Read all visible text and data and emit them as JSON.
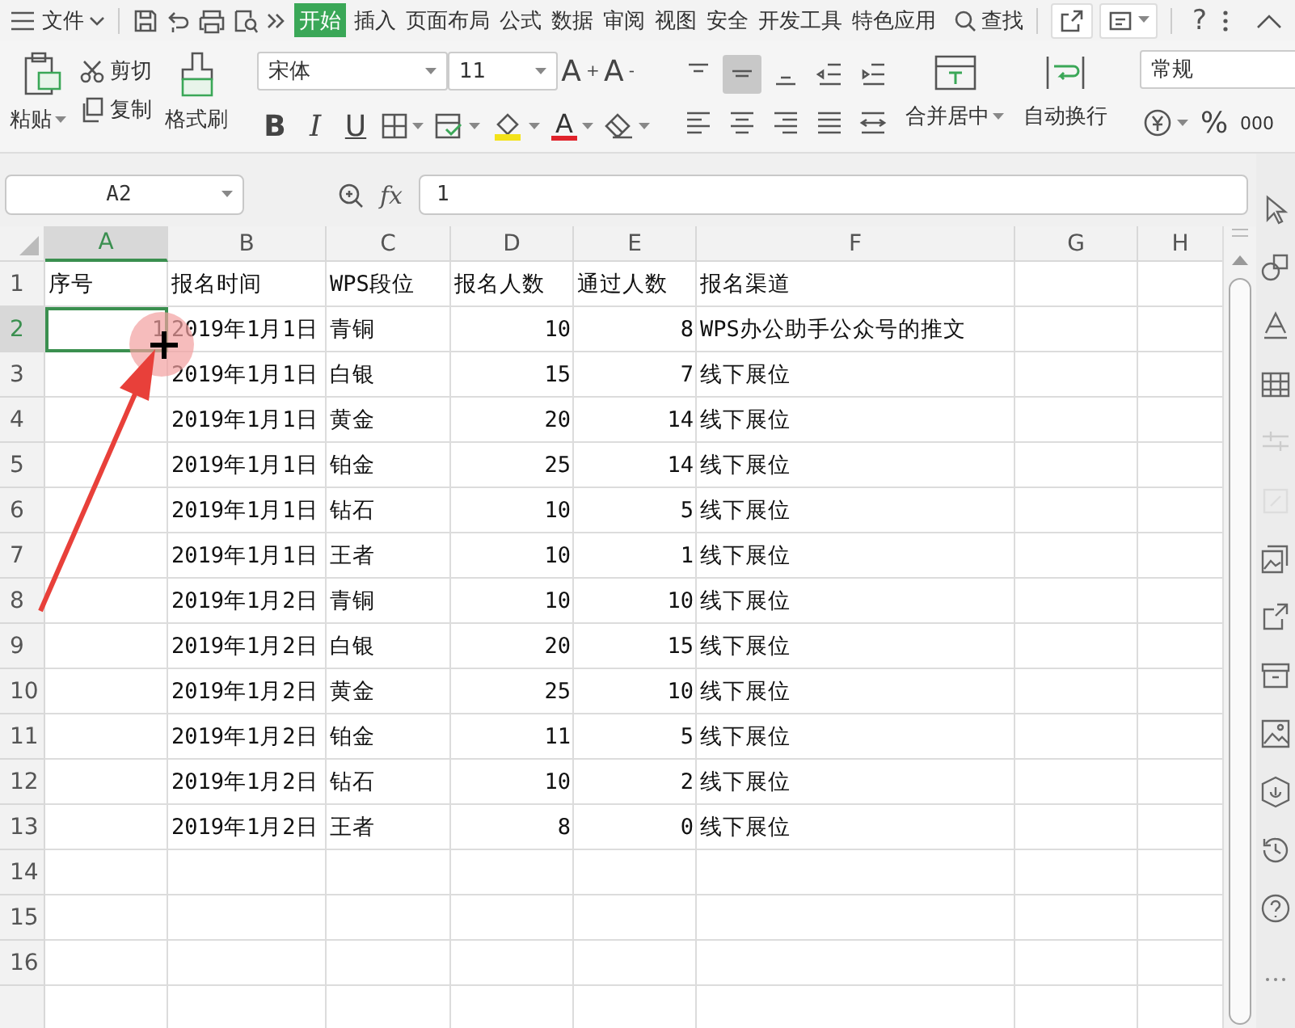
{
  "menu_bar": {
    "file_menu": "文件",
    "tabs": [
      {
        "label": "开始",
        "selected": true
      },
      {
        "label": "插入",
        "selected": false
      },
      {
        "label": "页面布局",
        "selected": false
      },
      {
        "label": "公式",
        "selected": false
      },
      {
        "label": "数据",
        "selected": false
      },
      {
        "label": "审阅",
        "selected": false
      },
      {
        "label": "视图",
        "selected": false
      },
      {
        "label": "安全",
        "selected": false
      },
      {
        "label": "开发工具",
        "selected": false
      },
      {
        "label": "特色应用",
        "selected": false
      }
    ],
    "search": "查找",
    "help": "?"
  },
  "ribbon": {
    "clipboard": {
      "paste": "粘贴",
      "cut": "剪切",
      "copy": "复制",
      "format_painter": "格式刷"
    },
    "font": {
      "name": "宋体",
      "size": "11",
      "grow": "A$^{+}$",
      "shrink": "A$^{-}$",
      "bold": "B",
      "italic": "I",
      "underline": "U",
      "font_color": "A"
    },
    "alignment": {
      "buttons": [
        {
          "kind": "top",
          "selected": false
        },
        {
          "kind": "middle",
          "selected": true
        },
        {
          "kind": "bottom",
          "selected": false
        },
        {
          "kind": "outdent",
          "selected": false
        },
        {
          "kind": "indent",
          "selected": false
        },
        {
          "kind": "left",
          "selected": false
        },
        {
          "kind": "center",
          "selected": false
        },
        {
          "kind": "right",
          "selected": false
        },
        {
          "kind": "justify",
          "selected": false
        },
        {
          "kind": "distributed",
          "selected": false
        }
      ],
      "merge_center": "合并居中",
      "wrap_text": "自动换行"
    },
    "number": {
      "format": "常规",
      "percent": "%",
      "thousands": "000"
    }
  },
  "formula_bar": {
    "name_box": "A2",
    "function_label": "fx",
    "value": "1"
  },
  "sheet": {
    "columns": [
      {
        "label": "A",
        "selected": true,
        "numeric": true
      },
      {
        "label": "B",
        "selected": false,
        "numeric": false
      },
      {
        "label": "C",
        "selected": false,
        "numeric": false
      },
      {
        "label": "D",
        "selected": false,
        "numeric": true
      },
      {
        "label": "E",
        "selected": false,
        "numeric": true
      },
      {
        "label": "F",
        "selected": false,
        "numeric": false
      },
      {
        "label": "G",
        "selected": false,
        "numeric": false
      },
      {
        "label": "H",
        "selected": false,
        "numeric": false
      }
    ],
    "rows": [
      {
        "number": "1",
        "selected": false,
        "kind": "header",
        "cells": [
          "序号",
          "报名时间",
          "WPS段位",
          "报名人数",
          "通过人数",
          "报名渠道"
        ]
      },
      {
        "number": "2",
        "selected": true,
        "kind": "data",
        "cells": [
          "1",
          "2019年1月1日",
          "青铜",
          "10",
          "8",
          "WPS办公助手公众号的推文"
        ]
      },
      {
        "number": "3",
        "selected": false,
        "kind": "data",
        "cells": [
          "",
          "2019年1月1日",
          "白银",
          "15",
          "7",
          "线下展位"
        ]
      },
      {
        "number": "4",
        "selected": false,
        "kind": "data",
        "cells": [
          "",
          "2019年1月1日",
          "黄金",
          "20",
          "14",
          "线下展位"
        ]
      },
      {
        "number": "5",
        "selected": false,
        "kind": "data",
        "cells": [
          "",
          "2019年1月1日",
          "铂金",
          "25",
          "14",
          "线下展位"
        ]
      },
      {
        "number": "6",
        "selected": false,
        "kind": "data",
        "cells": [
          "",
          "2019年1月1日",
          "钻石",
          "10",
          "5",
          "线下展位"
        ]
      },
      {
        "number": "7",
        "selected": false,
        "kind": "data",
        "cells": [
          "",
          "2019年1月1日",
          "王者",
          "10",
          "1",
          "线下展位"
        ]
      },
      {
        "number": "8",
        "selected": false,
        "kind": "data",
        "cells": [
          "",
          "2019年1月2日",
          "青铜",
          "10",
          "10",
          "线下展位"
        ]
      },
      {
        "number": "9",
        "selected": false,
        "kind": "data",
        "cells": [
          "",
          "2019年1月2日",
          "白银",
          "20",
          "15",
          "线下展位"
        ]
      },
      {
        "number": "10",
        "selected": false,
        "kind": "data",
        "cells": [
          "",
          "2019年1月2日",
          "黄金",
          "25",
          "10",
          "线下展位"
        ]
      },
      {
        "number": "11",
        "selected": false,
        "kind": "data",
        "cells": [
          "",
          "2019年1月2日",
          "铂金",
          "11",
          "5",
          "线下展位"
        ]
      },
      {
        "number": "12",
        "selected": false,
        "kind": "data",
        "cells": [
          "",
          "2019年1月2日",
          "钻石",
          "10",
          "2",
          "线下展位"
        ]
      },
      {
        "number": "13",
        "selected": false,
        "kind": "data",
        "cells": [
          "",
          "2019年1月2日",
          "王者",
          "8",
          "0",
          "线下展位"
        ]
      },
      {
        "number": "14",
        "selected": false,
        "kind": "data"
      },
      {
        "number": "15",
        "selected": false,
        "kind": "data"
      },
      {
        "number": "16",
        "selected": false,
        "kind": "data"
      }
    ]
  }
}
